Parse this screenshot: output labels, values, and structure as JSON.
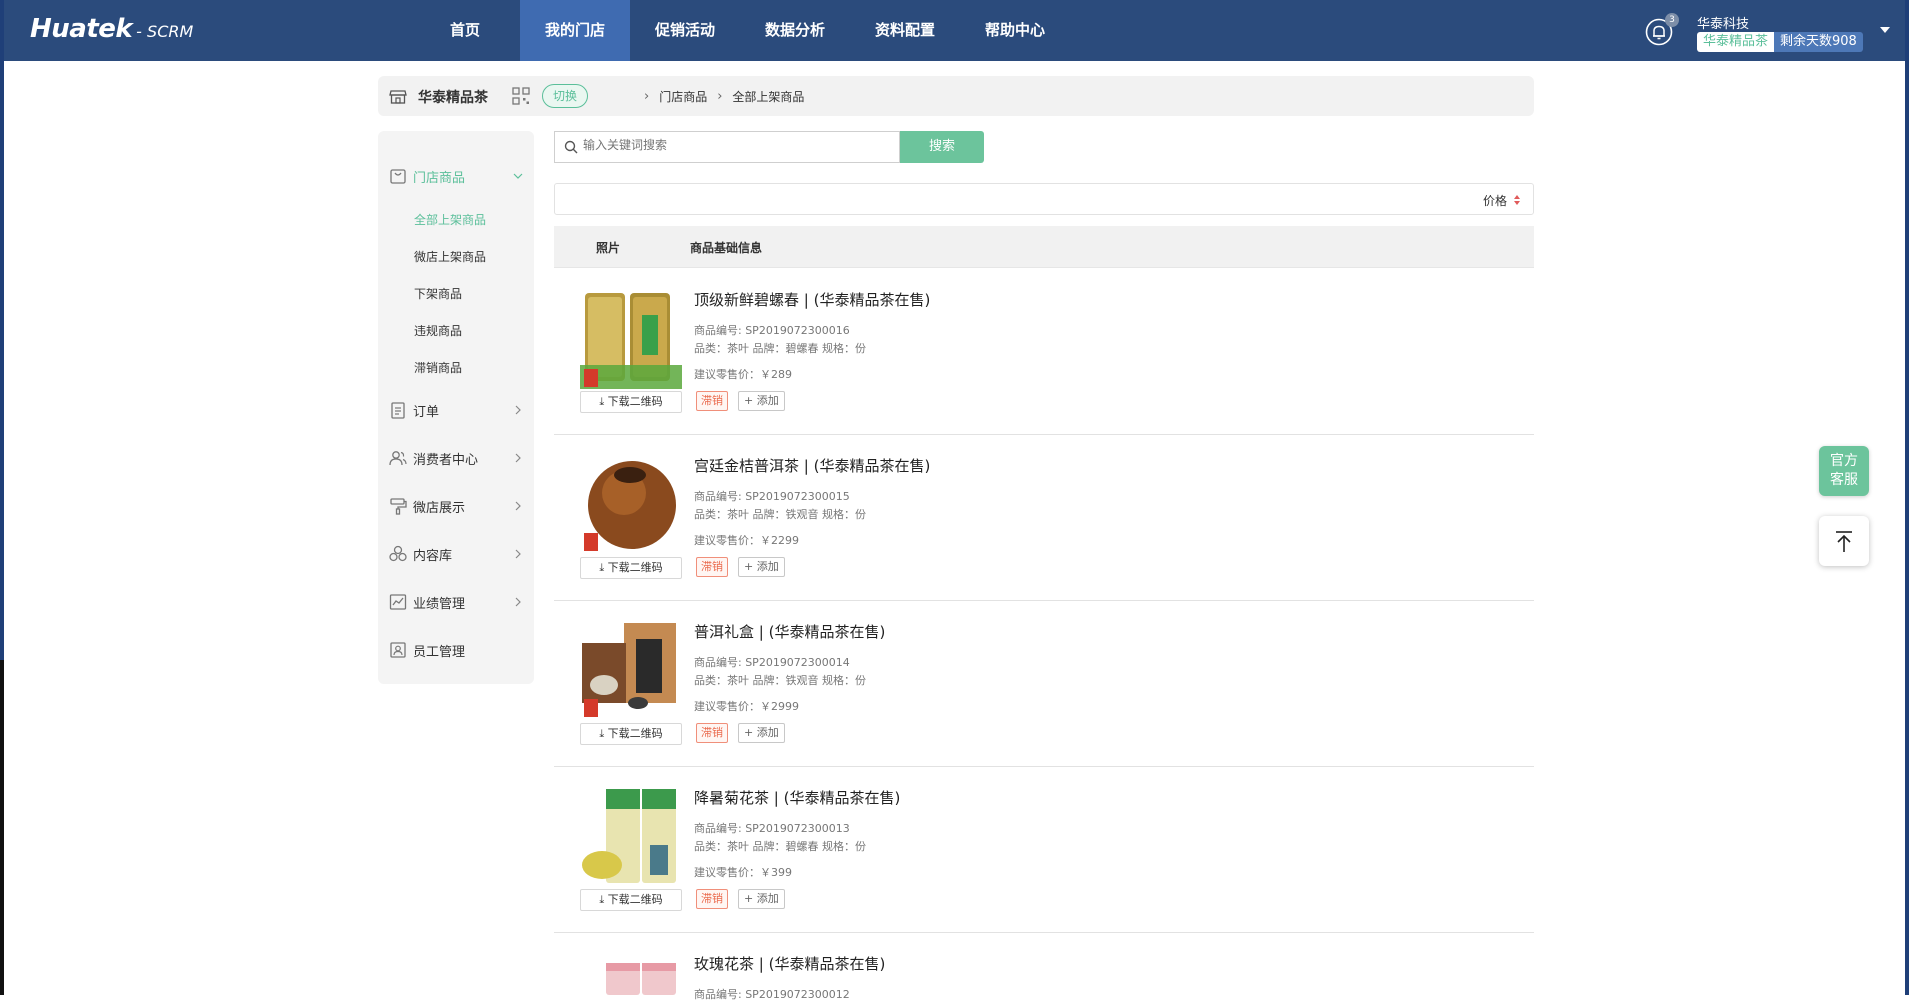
{
  "app": {
    "logo_main": "Huatek",
    "logo_sub": "- SCRM"
  },
  "nav": {
    "items": [
      {
        "label": "首页"
      },
      {
        "label": "我的门店"
      },
      {
        "label": "促销活动"
      },
      {
        "label": "数据分析"
      },
      {
        "label": "资料配置"
      },
      {
        "label": "帮助中心"
      }
    ],
    "active_index": 1
  },
  "user": {
    "notification_count": "3",
    "company": "华泰科技",
    "store_label": "华泰精品茶",
    "days_left": "剩余天数908"
  },
  "storebar": {
    "store_name": "华泰精品茶",
    "switch_label": "切换",
    "breadcrumb": [
      "门店商品",
      "全部上架商品"
    ]
  },
  "sidebar": {
    "group_label": "门店商品",
    "sub_items": [
      {
        "label": "全部上架商品"
      },
      {
        "label": "微店上架商品"
      },
      {
        "label": "下架商品"
      },
      {
        "label": "违规商品"
      },
      {
        "label": "滞销商品"
      }
    ],
    "menus": [
      {
        "label": "订单"
      },
      {
        "label": "消费者中心"
      },
      {
        "label": "微店展示"
      },
      {
        "label": "内容库"
      },
      {
        "label": "业绩管理"
      },
      {
        "label": "员工管理"
      }
    ]
  },
  "search": {
    "placeholder": "输入关键词搜索",
    "button_label": "搜索"
  },
  "sort": {
    "label": "价格"
  },
  "table": {
    "col_photo": "照片",
    "col_info": "商品基础信息"
  },
  "products": [
    {
      "title": "顶级新鲜碧螺春 | (华泰精品茶在售)",
      "code": "商品编号: SP2019072300016",
      "meta": "品类：茶叶    品牌：碧螺春    规格：份",
      "price": "建议零售价：￥289",
      "tag": "滞销",
      "add": "+ 添加",
      "download": "下载二维码"
    },
    {
      "title": "宫廷金桔普洱茶 | (华泰精品茶在售)",
      "code": "商品编号: SP2019072300015",
      "meta": "品类：茶叶    品牌：铁观音    规格：份",
      "price": "建议零售价：￥2299",
      "tag": "滞销",
      "add": "+ 添加",
      "download": "下载二维码"
    },
    {
      "title": "普洱礼盒 | (华泰精品茶在售)",
      "code": "商品编号: SP2019072300014",
      "meta": "品类：茶叶    品牌：铁观音    规格：份",
      "price": "建议零售价：￥2999",
      "tag": "滞销",
      "add": "+ 添加",
      "download": "下载二维码"
    },
    {
      "title": "降暑菊花茶 | (华泰精品茶在售)",
      "code": "商品编号: SP2019072300013",
      "meta": "品类：茶叶    品牌：碧螺春    规格：份",
      "price": "建议零售价：￥399",
      "tag": "滞销",
      "add": "+ 添加",
      "download": "下载二维码"
    },
    {
      "title": "玫瑰花茶 | (华泰精品茶在售)",
      "code": "商品编号: SP2019072300012"
    }
  ],
  "float": {
    "service_line1": "官方",
    "service_line2": "客服"
  },
  "colors": {
    "header": "#2b4b7c",
    "nav_active": "#3f6bb1",
    "accent_green": "#5bbf9a",
    "tag_red": "#ea6a4d"
  }
}
